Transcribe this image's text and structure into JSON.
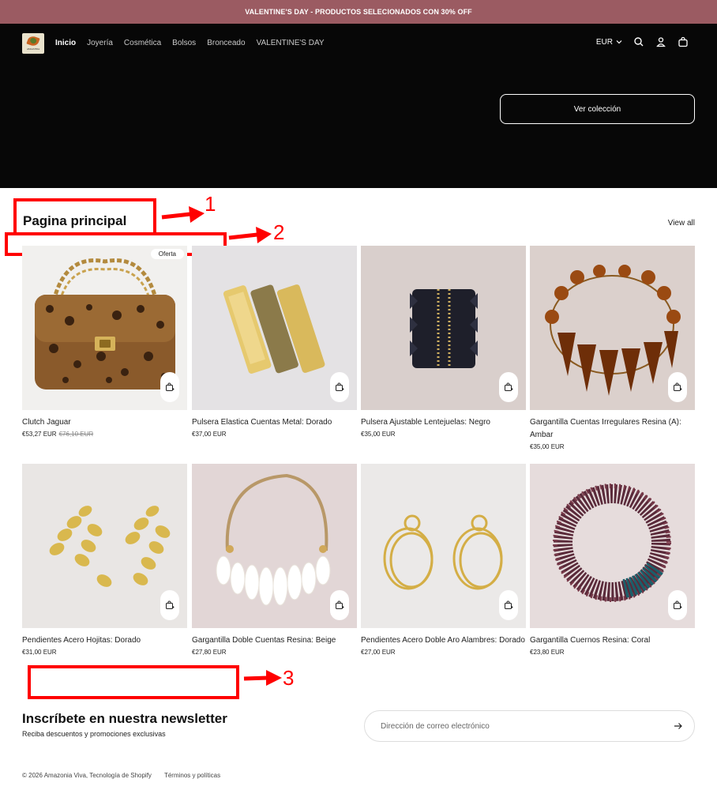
{
  "announcement": "VALENTINE'S DAY - PRODUCTOS SELECIONADOS CON 30% OFF",
  "logo_text": "AMAZONIA",
  "nav": [
    "Inicio",
    "Joyería",
    "Cosmética",
    "Bolsos",
    "Bronceado",
    "VALENTINE'S DAY"
  ],
  "header": {
    "currency": "EUR"
  },
  "hero": {
    "button": "Ver colección"
  },
  "section": {
    "title": "Pagina principal",
    "view_all": "View all"
  },
  "annotations": [
    "1",
    "2",
    "3"
  ],
  "products": [
    {
      "title": "Clutch Jaguar",
      "price": "€53,27 EUR",
      "old_price": "€76,10 EUR",
      "badge": "Oferta"
    },
    {
      "title": "Pulsera Elastica Cuentas Metal: Dorado",
      "price": "€37,00 EUR"
    },
    {
      "title": "Pulsera Ajustable Lentejuelas: Negro",
      "price": "€35,00 EUR"
    },
    {
      "title": "Gargantilla Cuentas Irregulares Resina (A): Ambar",
      "price": "€35,00 EUR"
    },
    {
      "title": "Pendientes Acero Hojitas: Dorado",
      "price": "€31,00 EUR"
    },
    {
      "title": "Gargantilla Doble Cuentas Resina: Beige",
      "price": "€27,80 EUR"
    },
    {
      "title": "Pendientes Acero Doble Aro Alambres: Dorado",
      "price": "€27,00 EUR"
    },
    {
      "title": "Gargantilla Cuernos Resina: Coral",
      "price": "€23,80 EUR"
    }
  ],
  "newsletter": {
    "title": "Inscríbete en nuestra newsletter",
    "subtitle": "Reciba descuentos y promociones exclusivas",
    "placeholder": "Dirección de correo electrónico"
  },
  "footer": {
    "copyright": "© 2026 Amazonia Viva, Tecnología de Shopify",
    "link": "Términos y políticas"
  }
}
